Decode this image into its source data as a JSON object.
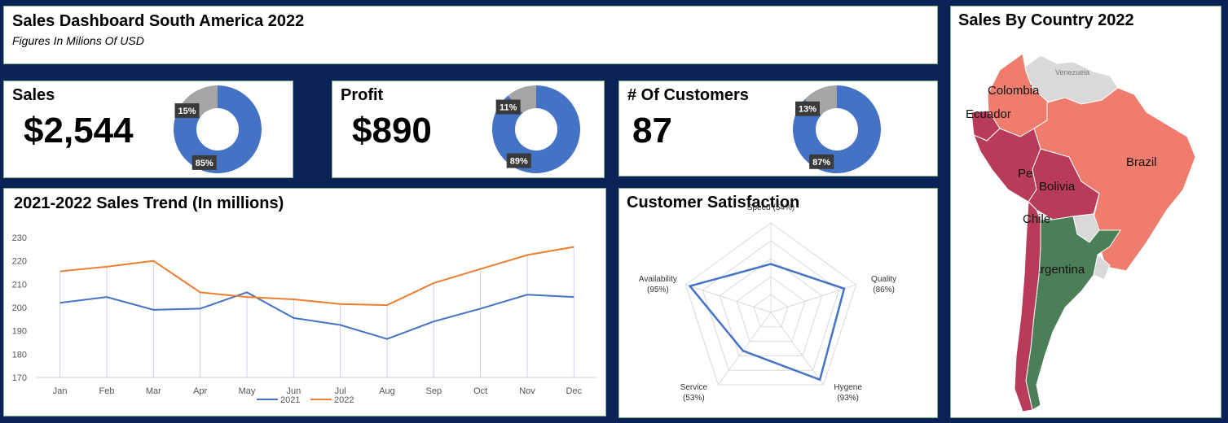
{
  "header": {
    "title": "Sales Dashboard South America 2022",
    "subtitle": "Figures In Milions Of USD"
  },
  "kpis": [
    {
      "title": "Sales",
      "value": "$2,544",
      "pct_main": 85,
      "pct_rest": 15,
      "main_label": "85%",
      "rest_label": "15%"
    },
    {
      "title": "Profit",
      "value": "$890",
      "pct_main": 89,
      "pct_rest": 11,
      "main_label": "89%",
      "rest_label": "11%"
    },
    {
      "title": "# Of Customers",
      "value": "87",
      "pct_main": 87,
      "pct_rest": 13,
      "main_label": "87%",
      "rest_label": "13%"
    }
  ],
  "colors": {
    "blue": "#4472c4",
    "orange": "#ed7d31",
    "gray": "#a5a5a5",
    "navy": "#0b2258",
    "brazil": "#ef7c6c",
    "peru": "#b83c5a",
    "argentina": "#4a7f58",
    "other": "#d9d9d9"
  },
  "trend": {
    "title": "2021-2022 Sales Trend (In millions)"
  },
  "satisfaction": {
    "title": "Customer Satisfaction",
    "labels": [
      {
        "name": "Speed",
        "pct": "(54%)"
      },
      {
        "name": "Quality",
        "pct": "(86%)"
      },
      {
        "name": "Hygene",
        "pct": "(93%)"
      },
      {
        "name": "Service",
        "pct": "(53%)"
      },
      {
        "name": "Availability",
        "pct": "(95%)"
      }
    ]
  },
  "map": {
    "title": "Sales By Country 2022",
    "countries": [
      "Colombia",
      "Ecuador",
      "Brazil",
      "Peru",
      "Bolivia",
      "Chile",
      "Argentina",
      "Venezuela"
    ]
  },
  "chart_data": [
    {
      "type": "pie",
      "title": "Sales",
      "values": [
        85,
        15
      ],
      "labels": [
        "85%",
        "15%"
      ]
    },
    {
      "type": "pie",
      "title": "Profit",
      "values": [
        89,
        11
      ],
      "labels": [
        "89%",
        "11%"
      ]
    },
    {
      "type": "pie",
      "title": "# Of Customers",
      "values": [
        87,
        13
      ],
      "labels": [
        "87%",
        "13%"
      ]
    },
    {
      "type": "line",
      "title": "2021-2022 Sales Trend (In millions)",
      "categories": [
        "Jan",
        "Feb",
        "Mar",
        "Apr",
        "May",
        "Jun",
        "Jul",
        "Aug",
        "Sep",
        "Oct",
        "Nov",
        "Dec"
      ],
      "series": [
        {
          "name": "2021",
          "values": [
            202,
            204.5,
            199,
            199.5,
            206.5,
            195.5,
            192.5,
            186.5,
            194,
            199.5,
            205.5,
            204.5
          ]
        },
        {
          "name": "2022",
          "values": [
            215.5,
            217.5,
            220,
            206.5,
            204.5,
            203.5,
            201.5,
            201,
            210.5,
            216.5,
            222.5,
            226
          ]
        }
      ],
      "ylim": [
        170,
        230
      ],
      "yticks": [
        170,
        180,
        190,
        200,
        210,
        220,
        230
      ],
      "legend": "bottom"
    },
    {
      "type": "radar",
      "title": "Customer Satisfaction",
      "categories": [
        "Speed",
        "Quality",
        "Hygene",
        "Service",
        "Availability"
      ],
      "values": [
        54,
        86,
        93,
        53,
        95
      ],
      "rlim": [
        0,
        100
      ]
    }
  ]
}
